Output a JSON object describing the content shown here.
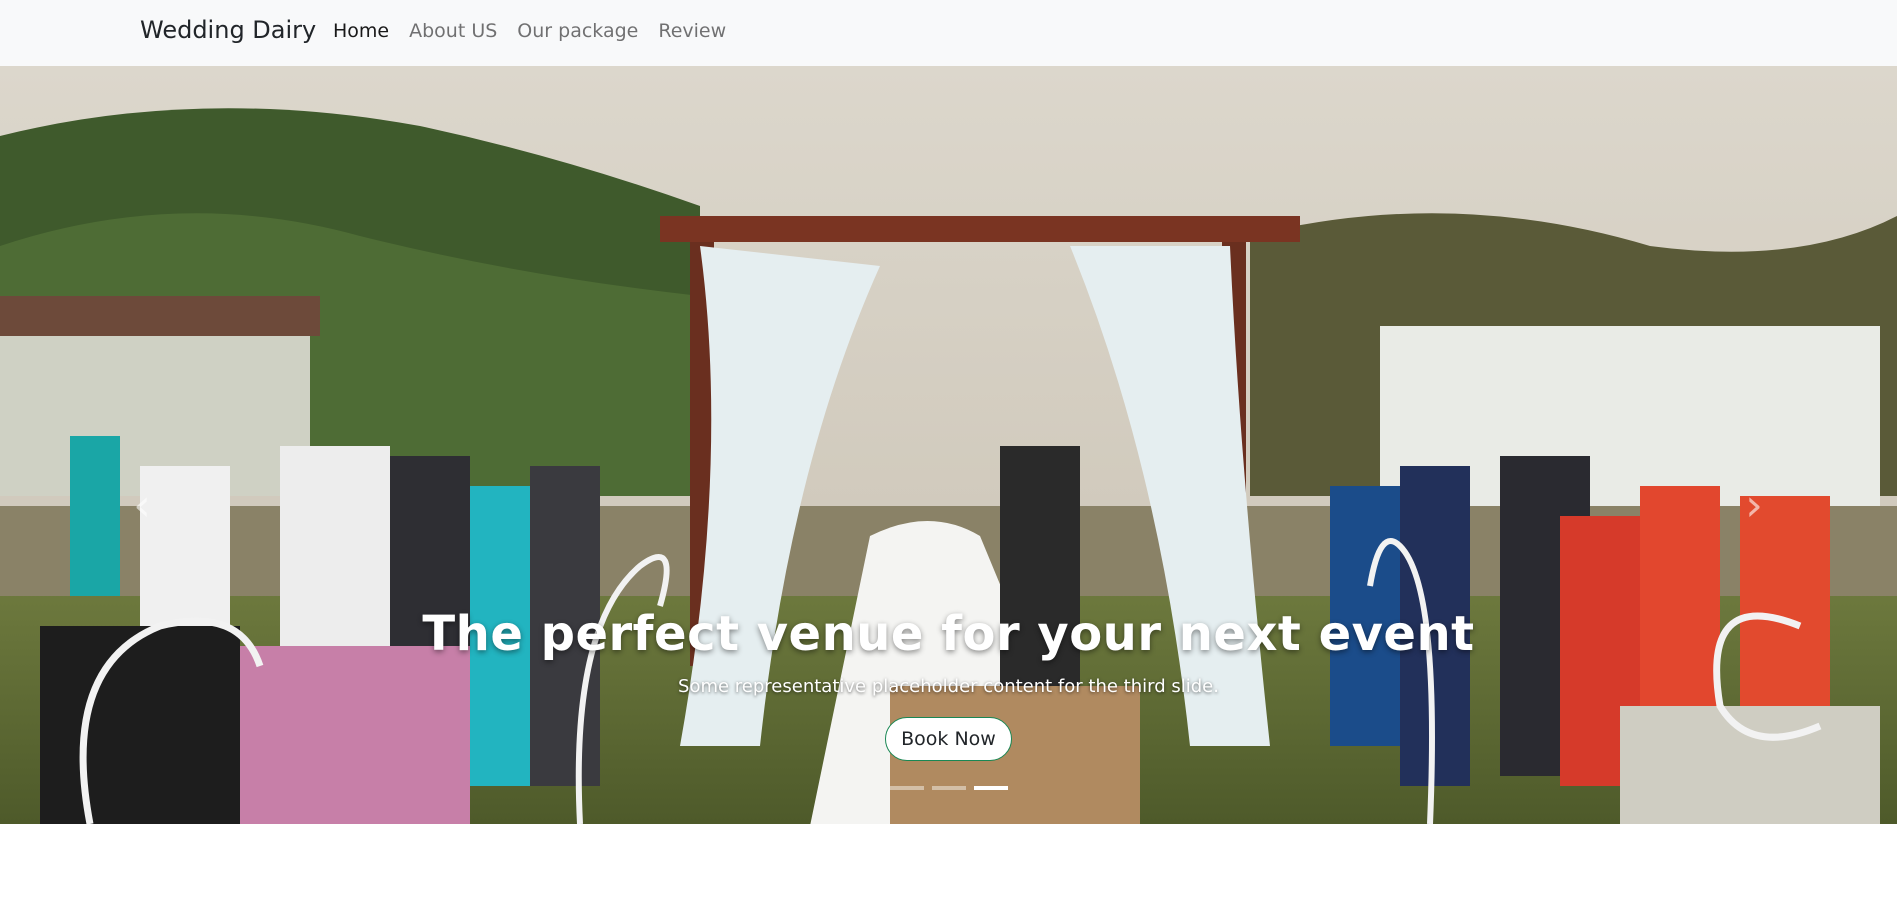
{
  "navbar": {
    "brand": "Wedding Dairy",
    "links": [
      {
        "label": "Home",
        "active": true
      },
      {
        "label": "About US",
        "active": false
      },
      {
        "label": "Our package",
        "active": false
      },
      {
        "label": "Review",
        "active": false
      }
    ]
  },
  "carousel": {
    "prev_icon": "chevron-left-icon",
    "next_icon": "chevron-right-icon",
    "prev_glyph": "‹",
    "next_glyph": "›",
    "caption_title": "The perfect venue for your next event",
    "caption_text": "Some representative placeholder content for the third slide.",
    "button_label": "Book Now",
    "indicator_count": 3,
    "active_indicator": 3
  }
}
